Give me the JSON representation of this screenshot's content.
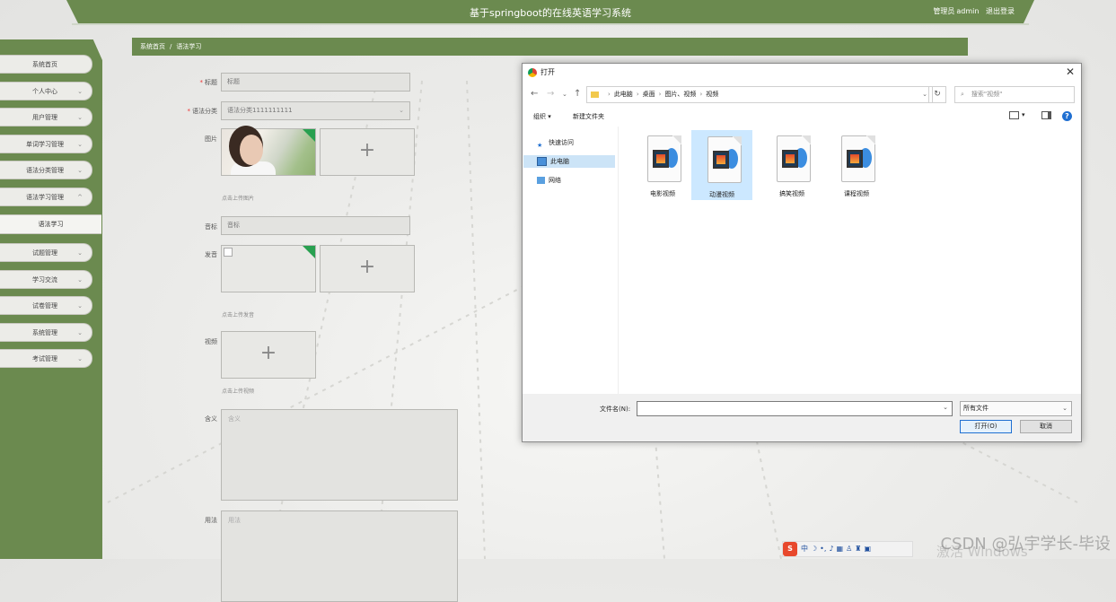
{
  "header": {
    "title": "基于springboot的在线英语学习系统",
    "user_role": "管理员",
    "username": "admin",
    "logout": "退出登录"
  },
  "sidebar": {
    "items": [
      {
        "label": "系统首页",
        "expandable": false
      },
      {
        "label": "个人中心",
        "expandable": true
      },
      {
        "label": "用户管理",
        "expandable": true
      },
      {
        "label": "单词学习管理",
        "expandable": true
      },
      {
        "label": "语法分类管理",
        "expandable": true
      },
      {
        "label": "语法学习管理",
        "expandable": true,
        "expanded": true
      },
      {
        "label": "语法学习",
        "sub": true
      },
      {
        "label": "试题管理",
        "expandable": true
      },
      {
        "label": "学习交流",
        "expandable": true
      },
      {
        "label": "试卷管理",
        "expandable": true
      },
      {
        "label": "系统管理",
        "expandable": true
      },
      {
        "label": "考试管理",
        "expandable": true
      }
    ]
  },
  "breadcrumb": {
    "home": "系统首页",
    "sep": "/",
    "current": "语法学习"
  },
  "form": {
    "title_label": "标题",
    "title_value": "标题",
    "category_label": "语法分类",
    "category_value": "语法分类1111111111",
    "image_label": "图片",
    "image_hint": "点击上传图片",
    "phonetic_label": "音标",
    "phonetic_placeholder": "音标",
    "audio_label": "发音",
    "audio_hint": "点击上传发音",
    "video_label": "视频",
    "video_hint": "点击上传视频",
    "meaning_label": "含义",
    "meaning_placeholder": "含义",
    "usage_label": "用法",
    "usage_placeholder": "用法",
    "plus": "+"
  },
  "dialog": {
    "title": "打开",
    "close": "✕",
    "path": [
      "此电脑",
      "桌面",
      "图片、视频",
      "视频"
    ],
    "search_placeholder": "搜索\"视频\"",
    "organize": "组织 ▾",
    "new_folder": "新建文件夹",
    "help": "?",
    "nav": [
      {
        "label": "快速访问",
        "icon": "pin-icon"
      },
      {
        "label": "此电脑",
        "icon": "computer-icon",
        "selected": true
      },
      {
        "label": "网络",
        "icon": "network-icon"
      }
    ],
    "files": [
      {
        "name": "电影视频",
        "selected": false
      },
      {
        "name": "动漫视频",
        "selected": true
      },
      {
        "name": "搞笑视频",
        "selected": false
      },
      {
        "name": "课程视频",
        "selected": false
      }
    ],
    "filename_label": "文件名(N):",
    "filename_value": "",
    "filetype": "所有文件",
    "open_button": "打开(O)",
    "cancel_button": "取消"
  },
  "taskbar": {
    "ime": "中",
    "activate": "激活 Windows"
  },
  "watermark": "CSDN @弘宇学长-毕设",
  "colors": {
    "brand_green": "#6b8a4f",
    "accent_blue": "#1f6fd1",
    "selected_bg": "#cce8ff"
  }
}
